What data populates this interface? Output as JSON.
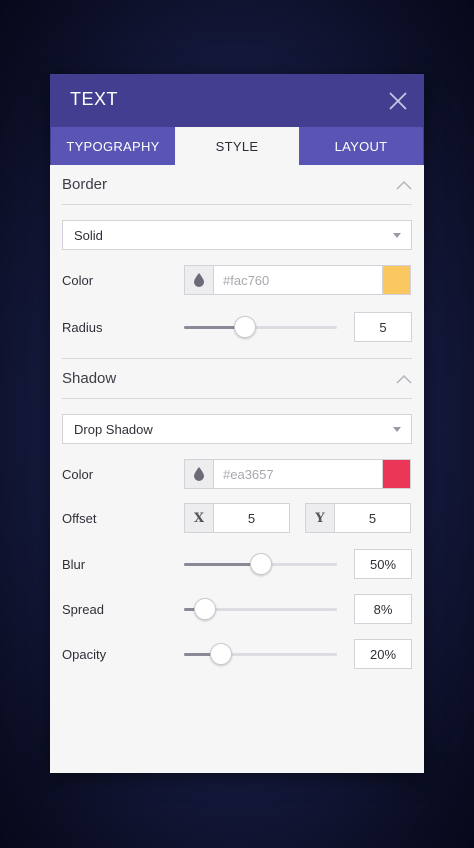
{
  "header": {
    "title": "TEXT"
  },
  "tabs": [
    {
      "label": "TYPOGRAPHY"
    },
    {
      "label": "STYLE"
    },
    {
      "label": "LAYOUT"
    }
  ],
  "border": {
    "title": "Border",
    "style_value": "Solid",
    "color_label": "Color",
    "color_hex": "#fac760",
    "color_swatch": "#fac760",
    "radius_label": "Radius",
    "radius_value": "5",
    "radius_fraction": 0.38
  },
  "shadow": {
    "title": "Shadow",
    "type_value": "Drop Shadow",
    "color_label": "Color",
    "color_hex": "#ea3657",
    "color_swatch": "#ea3657",
    "offset_label": "Offset",
    "offset_x_axis": "X",
    "offset_x": "5",
    "offset_y_axis": "Y",
    "offset_y": "5",
    "blur_label": "Blur",
    "blur_value": "50%",
    "blur_fraction": 0.5,
    "spread_label": "Spread",
    "spread_value": "8%",
    "spread_fraction": 0.08,
    "opacity_label": "Opacity",
    "opacity_value": "20%",
    "opacity_fraction": 0.2
  },
  "colors": {
    "header_bg": "#433e90",
    "tab_bg": "#5a55b4"
  },
  "icons": [
    "close-icon",
    "chevron-up-icon",
    "dropdown-caret-icon",
    "droplet-icon"
  ]
}
